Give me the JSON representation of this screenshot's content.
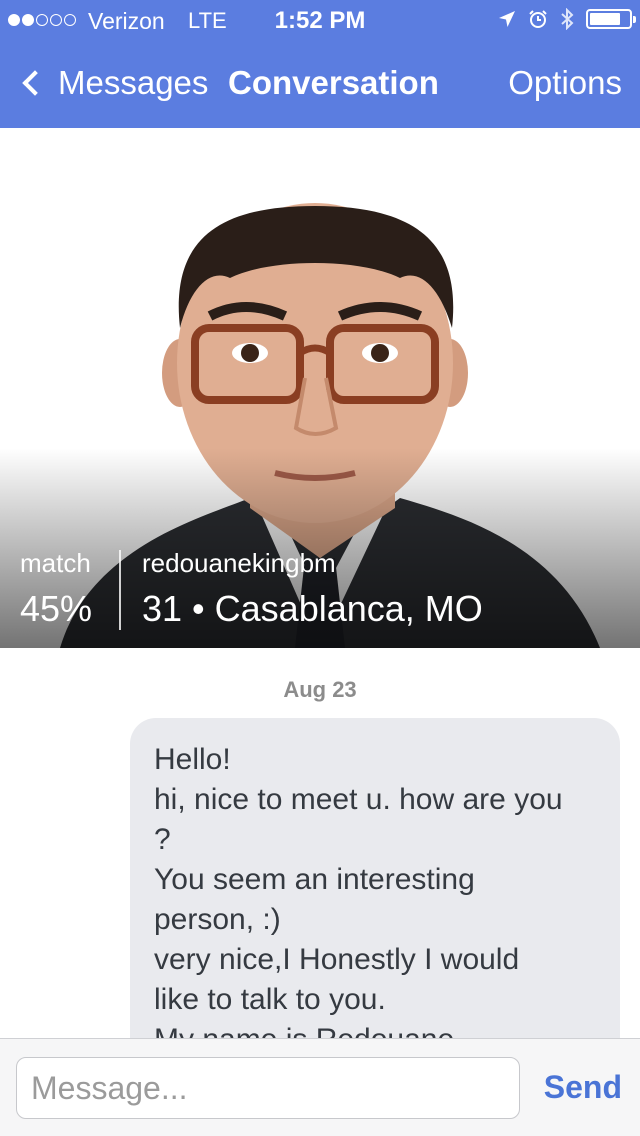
{
  "status_bar": {
    "carrier": "Verizon",
    "network": "LTE",
    "time": "1:52 PM",
    "signal_bars_filled": 2,
    "signal_bars_total": 5
  },
  "nav": {
    "back_label": "Messages",
    "title": "Conversation",
    "options_label": "Options"
  },
  "profile": {
    "match_label": "match",
    "match_value": "45%",
    "username": "redouanekingbm",
    "details": "31 • Casablanca, MO"
  },
  "conversation": {
    "date": "Aug 23",
    "messages": [
      {
        "lines": [
          "Hello!",
          "hi, nice to meet u. how are you",
          "?",
          "You seem an interesting",
          "person, :)",
          "very nice,I Honestly I would",
          "like to talk to you.",
          "My name is Redouane."
        ]
      }
    ]
  },
  "composer": {
    "placeholder": "Message...",
    "value": "",
    "send_label": "Send"
  },
  "colors": {
    "nav_background": "#5b7de0",
    "bubble_background": "#e9eaee",
    "send_text": "#4a74d6"
  },
  "icons": [
    "location-arrow-icon",
    "alarm-icon",
    "bluetooth-icon",
    "battery-icon",
    "back-chevron-icon"
  ]
}
